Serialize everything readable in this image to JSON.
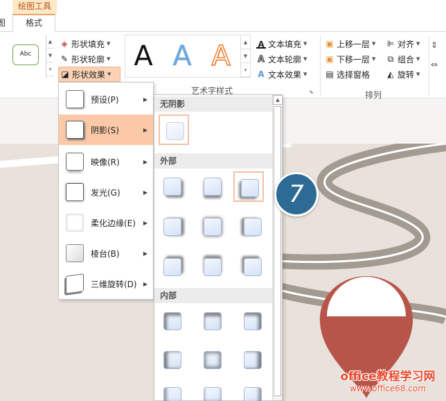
{
  "tabs": {
    "contextual_header": "绘图工具",
    "left_partial": "图",
    "format": "格式"
  },
  "shape_styles": {
    "preview_text": "Abc",
    "fill": "形状填充",
    "outline": "形状轮廓",
    "effects": "形状效果"
  },
  "wordart": {
    "letters": [
      "A",
      "A",
      "A"
    ],
    "letter_colors": [
      "#111111",
      "#5b9bd5",
      "#ed7d31"
    ],
    "group_label": "艺术字样式"
  },
  "text_cmds": {
    "fill": "文本填充",
    "outline": "文本轮廓",
    "effects": "文本效果"
  },
  "arrange": {
    "bring_forward": "上移一层",
    "send_backward": "下移一层",
    "selection_pane": "选择窗格",
    "align": "对齐",
    "group": "组合",
    "rotate": "旋转",
    "group_label": "排列"
  },
  "effects_menu": {
    "items": [
      {
        "label": "预设(P)",
        "icon": "preset-icon"
      },
      {
        "label": "阴影(S)",
        "icon": "shadow-icon",
        "active": true
      },
      {
        "label": "映像(R)",
        "icon": "reflection-icon"
      },
      {
        "label": "发光(G)",
        "icon": "glow-icon"
      },
      {
        "label": "柔化边缘(E)",
        "icon": "soft-edges-icon"
      },
      {
        "label": "棱台(B)",
        "icon": "bevel-icon"
      },
      {
        "label": "三维旋转(D)",
        "icon": "3d-rotation-icon"
      }
    ]
  },
  "shadow_panel": {
    "no_shadow": "无阴影",
    "outer": "外部",
    "inner": "内部"
  },
  "step_number": "7",
  "watermark": {
    "line1": "office教程学习网",
    "line2": "www.office68.com"
  },
  "colors": {
    "accent_orange": "#f0a46b",
    "active_highlight": "#fbc9a8",
    "step_circle": "#2d6a94",
    "pin_red": "#b8554a"
  }
}
